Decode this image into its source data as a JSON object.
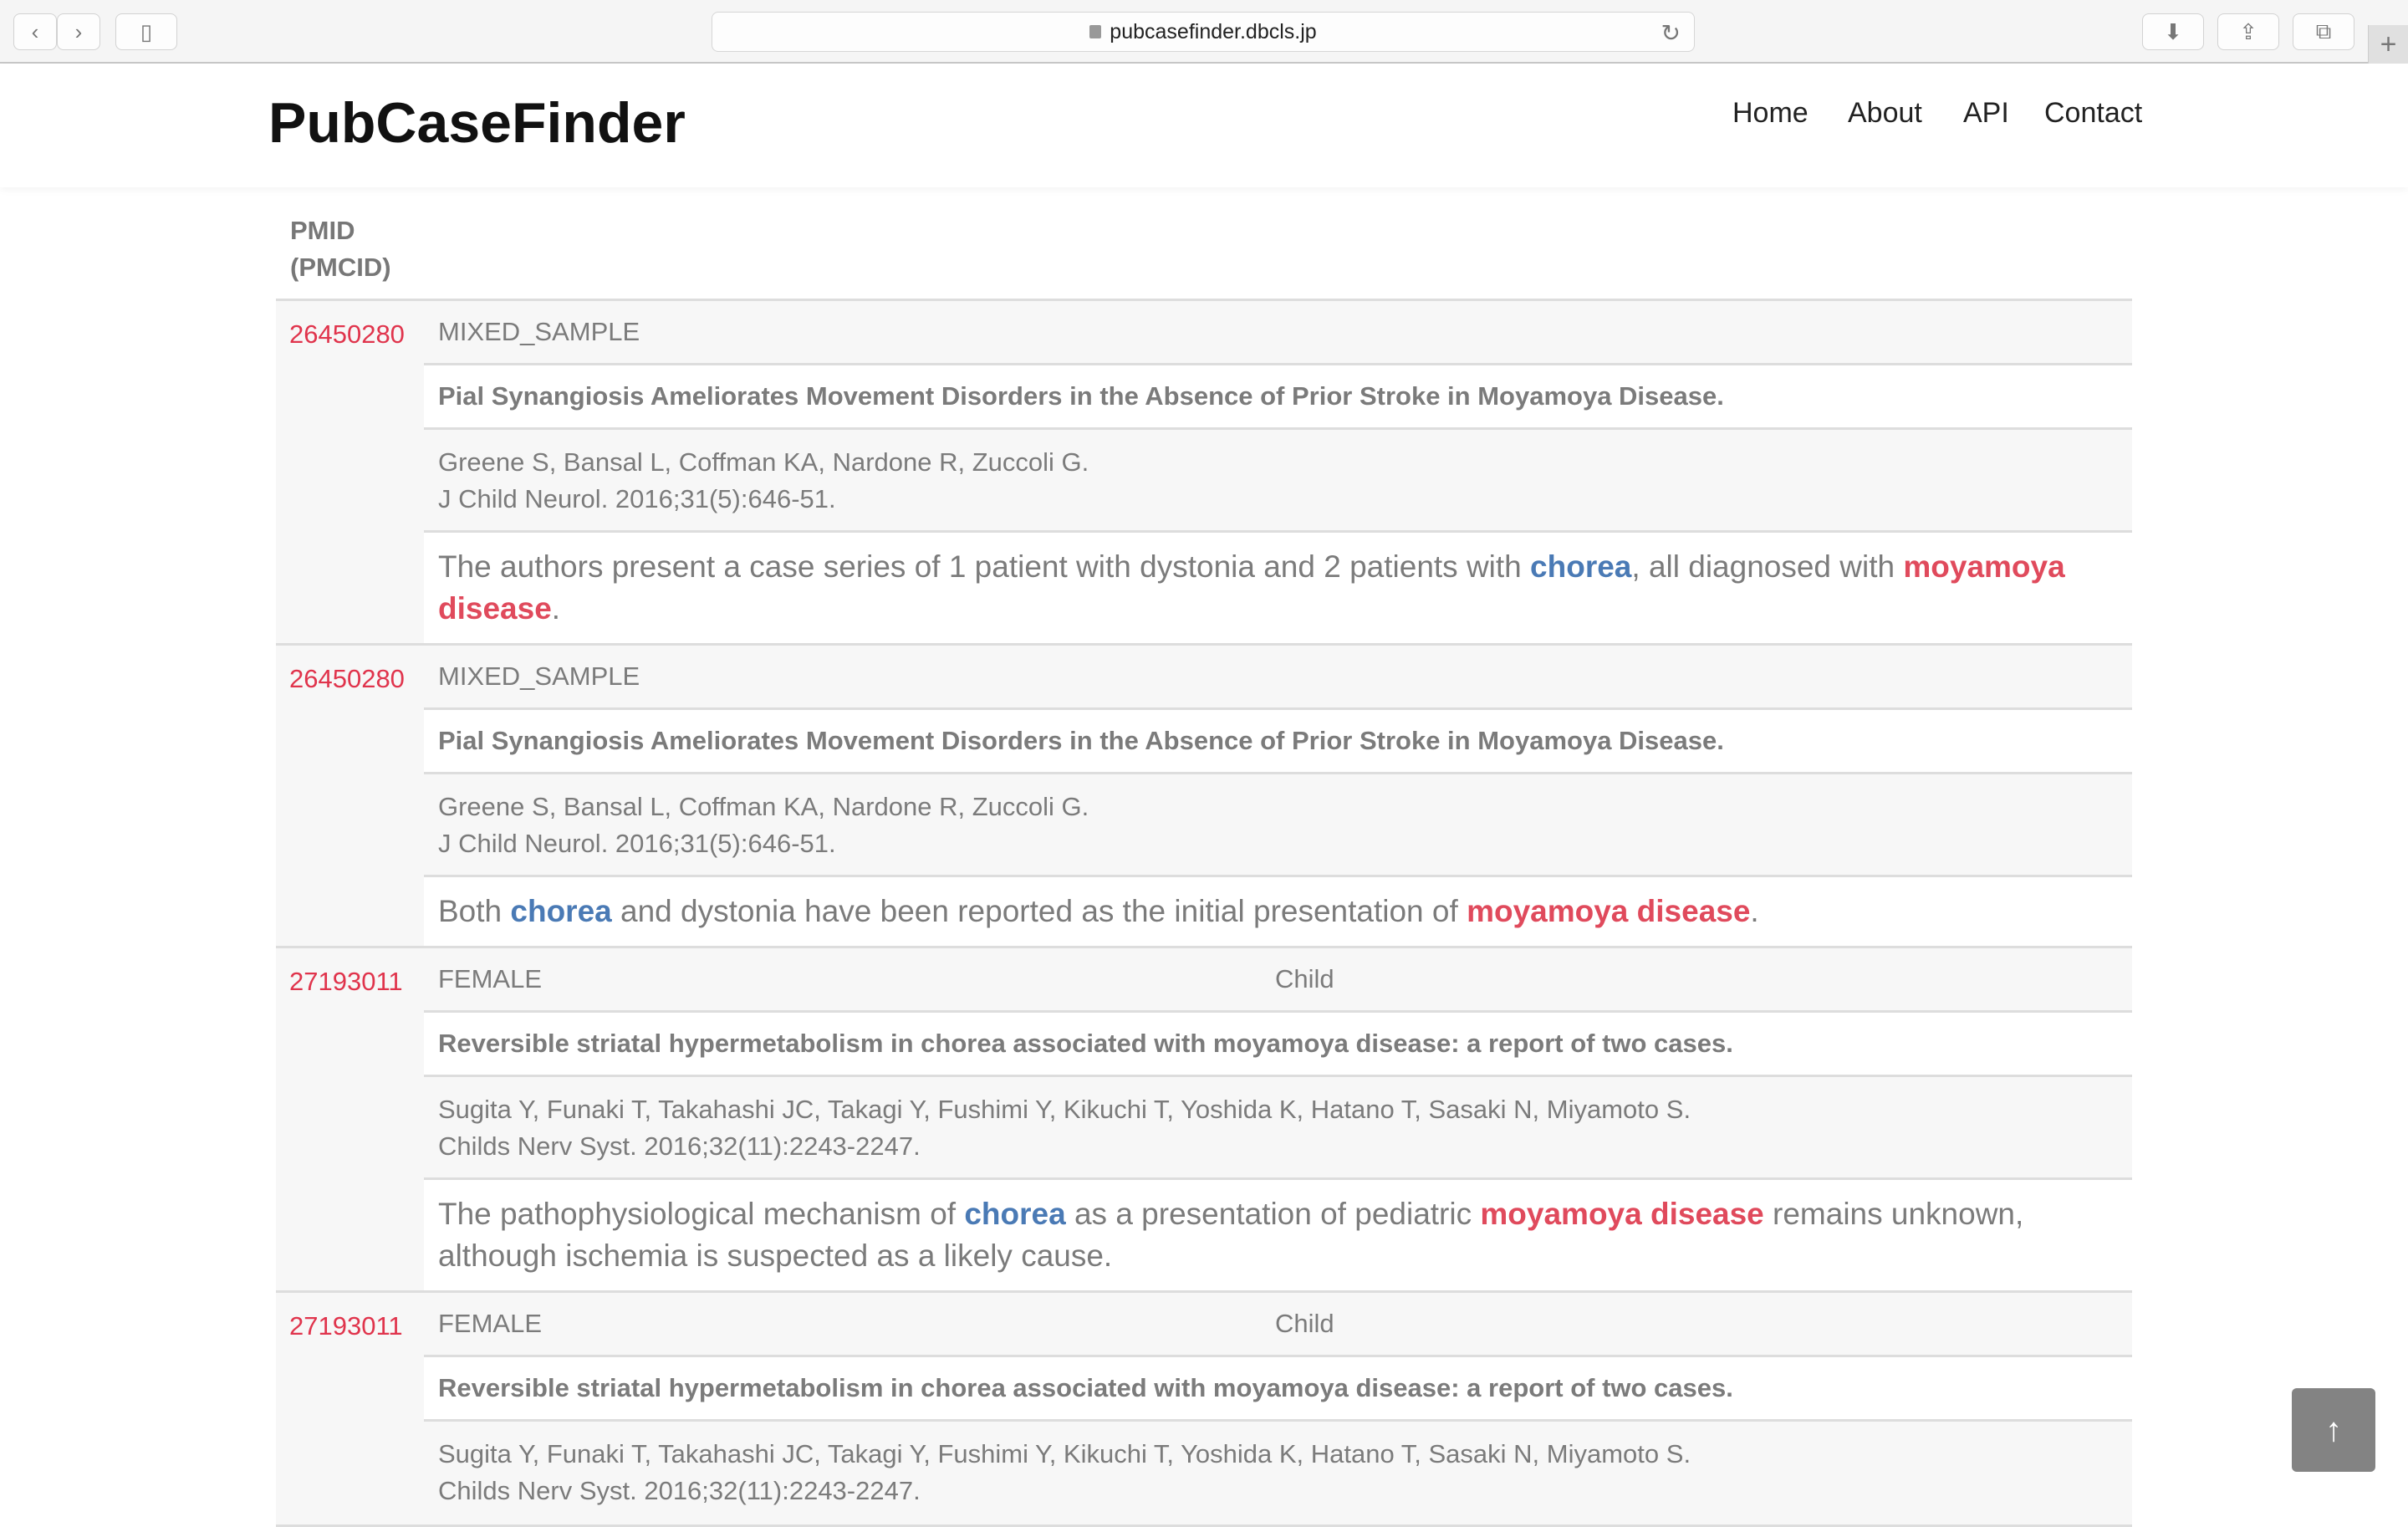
{
  "browser": {
    "url": "pubcasefinder.dbcls.jp",
    "back_icon": "‹",
    "forward_icon": "›",
    "sidebar_icon": "▯",
    "reload_icon": "↻",
    "download_icon": "⬇",
    "share_icon": "⇪",
    "tabs_icon": "⧉",
    "new_tab_icon": "+"
  },
  "site": {
    "logo": "PubCaseFinder",
    "nav": [
      "Home",
      "About",
      "API",
      "Contact"
    ]
  },
  "table": {
    "header_line1": "PMID",
    "header_line2": "(PMCID)"
  },
  "entries": [
    {
      "pmid": "26450280",
      "category": "MIXED_SAMPLE",
      "age": "",
      "title": "Pial Synangiosis Ameliorates Movement Disorders in the Absence of Prior Stroke in Moyamoya Disease.",
      "authors": "Greene S, Bansal L, Coffman KA, Nardone R, Zuccoli G.",
      "journal": "J Child Neurol. 2016;31(5):646-51.",
      "sentence": [
        {
          "t": "The authors present a case series of 1 patient with dystonia and 2 patients with ",
          "k": "plain"
        },
        {
          "t": "chorea",
          "k": "blue"
        },
        {
          "t": ", all diagnosed with ",
          "k": "plain"
        },
        {
          "t": "moyamoya disease",
          "k": "red"
        },
        {
          "t": ".",
          "k": "plain"
        }
      ]
    },
    {
      "pmid": "26450280",
      "category": "MIXED_SAMPLE",
      "age": "",
      "title": "Pial Synangiosis Ameliorates Movement Disorders in the Absence of Prior Stroke in Moyamoya Disease.",
      "authors": "Greene S, Bansal L, Coffman KA, Nardone R, Zuccoli G.",
      "journal": "J Child Neurol. 2016;31(5):646-51.",
      "sentence": [
        {
          "t": "Both ",
          "k": "plain"
        },
        {
          "t": "chorea",
          "k": "blue"
        },
        {
          "t": " and dystonia have been reported as the initial presentation of ",
          "k": "plain"
        },
        {
          "t": "moyamoya disease",
          "k": "red"
        },
        {
          "t": ".",
          "k": "plain"
        }
      ]
    },
    {
      "pmid": "27193011",
      "category": "FEMALE",
      "age": "Child",
      "title": "Reversible striatal hypermetabolism in chorea associated with moyamoya disease: a report of two cases.",
      "authors": "Sugita Y, Funaki T, Takahashi JC, Takagi Y, Fushimi Y, Kikuchi T, Yoshida K, Hatano T, Sasaki N, Miyamoto S.",
      "journal": "Childs Nerv Syst. 2016;32(11):2243-2247.",
      "sentence": [
        {
          "t": "The pathophysiological mechanism of ",
          "k": "plain"
        },
        {
          "t": "chorea",
          "k": "blue"
        },
        {
          "t": " as a presentation of pediatric ",
          "k": "plain"
        },
        {
          "t": "moyamoya disease",
          "k": "red"
        },
        {
          "t": " remains unknown, although ischemia is suspected as a likely cause.",
          "k": "plain"
        }
      ]
    },
    {
      "pmid": "27193011",
      "category": "FEMALE",
      "age": "Child",
      "title": "Reversible striatal hypermetabolism in chorea associated with moyamoya disease: a report of two cases.",
      "authors": "Sugita Y, Funaki T, Takahashi JC, Takagi Y, Fushimi Y, Kikuchi T, Yoshida K, Hatano T, Sasaki N, Miyamoto S.",
      "journal": "Childs Nerv Syst. 2016;32(11):2243-2247.",
      "sentence": []
    }
  ],
  "back_to_top_icon": "↑",
  "colors": {
    "pmid": "#e0344c",
    "highlight_phenotype": "#4a7ab5",
    "highlight_disease": "#e04a5c",
    "text": "#7b7b7b"
  }
}
